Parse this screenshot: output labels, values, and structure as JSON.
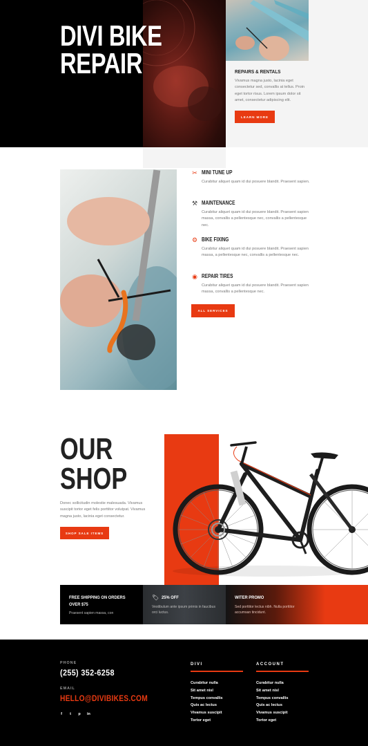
{
  "hero": {
    "title_line1": "DIVI BIKE",
    "title_line2": "REPAIR",
    "card_title": "REPAIRS & RENTALS",
    "card_text": "Vivamus magna justo, lacinia eget consectetur sed, convallis at tellus. Proin eget tortor risus. Lorem ipsum dolor sit amet, consectetur adipiscing elit.",
    "cta_label": "LEARN MORE"
  },
  "services": {
    "items": [
      {
        "icon": "wrench-icon",
        "title": "MINI TUNE UP",
        "text": "Curabitur aliquet quam id dui posuere blandit. Praesent sapien."
      },
      {
        "icon": "tools-icon",
        "title": "MAINTENANCE",
        "text": "Curabitur aliquet quam id dui posuere blandit. Praesent sapien massa, convallis a pellentesque nec, convallis a pellentesque nec."
      },
      {
        "icon": "gear-search-icon",
        "title": "BIKE FIXING",
        "text": "Curabitur aliquet quam id dui posuere blandit. Praesent sapien massa, a pellentesque nec, convallis a pellentesque nec."
      },
      {
        "icon": "tire-icon",
        "title": "REPAIR TIRES",
        "text": "Curabitur aliquet quam id dui posuere blandit. Praesent sapien massa, convallis a pellentesque nec."
      }
    ],
    "cta_label": "ALL SERVICES"
  },
  "shop": {
    "title_line1": "OUR",
    "title_line2": "SHOP",
    "text": "Donec sollicitudin molestie malesuada. Vivamus suscipit tortor eget felis porttitor volutpat. Vivamus magna justo, lacinia eget consectetur.",
    "cta_label": "SHOP SALE ITEMS"
  },
  "promos": [
    {
      "title": "FREE SHIPPING ON ORDERS OVER $75",
      "text": "Praesent sapien massa, con"
    },
    {
      "title": "25% OFF",
      "text": "Vestibulum ante ipsum primis in faucibus orci luctus."
    },
    {
      "title": "WITER PROMO",
      "text": "Sed porttitor lectus nibh. Nulla porttitor accumsan tincidunt."
    }
  ],
  "footer": {
    "phone_label": "PHONE",
    "phone": "(255) 352-6258",
    "email_label": "EMAIL",
    "email": "HELLO@DIVIBIKES.COM",
    "socials": [
      "f",
      "t",
      "p",
      "in"
    ],
    "col1_title": "DIVI",
    "col1_links": [
      "Curabitur nulla",
      "Sit amet nisl",
      "Tempus convallis",
      "Quis ac lectus",
      "Vivamus suscipit",
      "Tortor eget"
    ],
    "col2_title": "ACCOUNT",
    "col2_links": [
      "Curabitur nulla",
      "Sit amet nisl",
      "Tempus convallis",
      "Quis ac lectus",
      "Vivamus suscipit",
      "Tortor eget"
    ]
  },
  "colors": {
    "accent": "#e83a12",
    "dark": "#000000",
    "light_gray": "#f4f4f4"
  }
}
